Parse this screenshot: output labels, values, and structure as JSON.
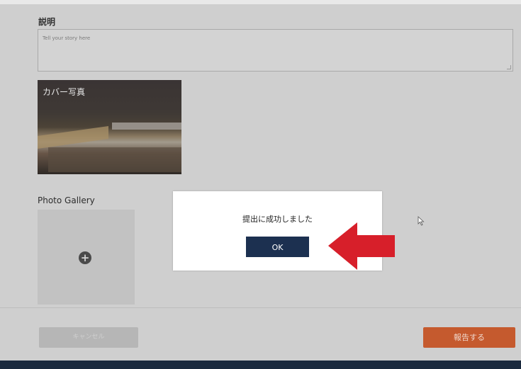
{
  "form": {
    "description_label": "説明",
    "description_placeholder": "Tell your story here",
    "cover_photo_label": "カバー写真",
    "gallery_label": "Photo Gallery",
    "gallery_add_icon": "plus-circle-icon"
  },
  "footer": {
    "secondary_button_label": "キャンセル",
    "submit_button_label": "報告する"
  },
  "dialog": {
    "message": "提出に成功しました",
    "ok_label": "OK"
  },
  "annotation": {
    "arrow_icon": "red-arrow-pointing-left",
    "arrow_color": "#d71f2a"
  },
  "colors": {
    "submit_button": "#c55a2e",
    "ok_button": "#1c3050",
    "bottom_bar": "#1a2a3e"
  }
}
